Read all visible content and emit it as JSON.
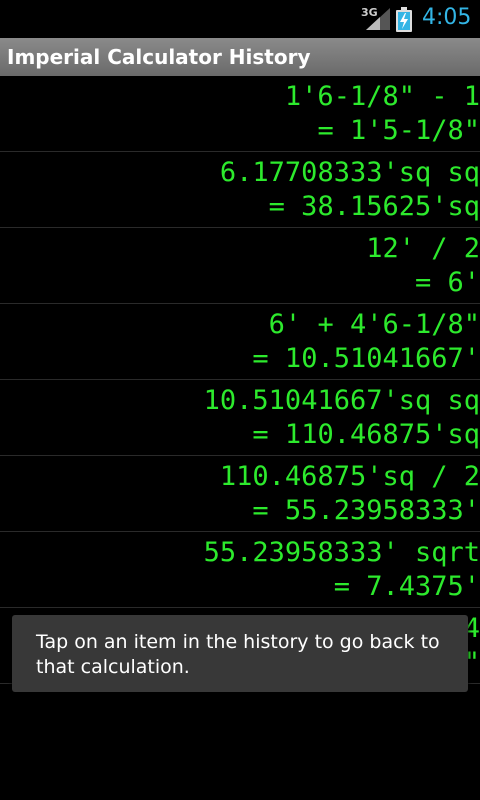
{
  "status_bar": {
    "network": "3G",
    "clock": "4:05",
    "signal_icon": "signal-bars",
    "battery_icon": "battery-charging"
  },
  "title_bar": {
    "title": "Imperial Calculator History"
  },
  "history": [
    {
      "expression": "1'6-1/8\" - 1",
      "result": "= 1'5-1/8\""
    },
    {
      "expression": "6.17708333'sq sq",
      "result": "= 38.15625'sq"
    },
    {
      "expression": "12' / 2",
      "result": "= 6'"
    },
    {
      "expression": "6' + 4'6-1/8\"",
      "result": "= 10.51041667'"
    },
    {
      "expression": "10.51041667'sq sq",
      "result": "= 110.46875'sq"
    },
    {
      "expression": "110.46875'sq / 2",
      "result": "= 55.23958333'"
    },
    {
      "expression": "55.23958333' sqrt",
      "result": "= 7.4375'"
    },
    {
      "expression": "4",
      "result": "\""
    }
  ],
  "toast": {
    "message": "Tap on an item in the history to go back to that calculation."
  },
  "colors": {
    "result_text": "#2dea2d",
    "clock": "#33b5e5",
    "toast_background": "#383838"
  }
}
